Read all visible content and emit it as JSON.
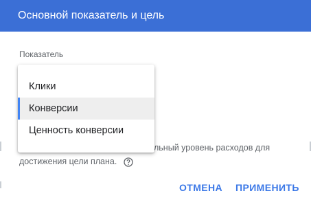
{
  "dialog": {
    "title": "Основной показатель и цель",
    "metric_label": "Показатель",
    "description_visible": "льный уровень расходов для",
    "description_line2": "достижения цели плана.",
    "help_icon": "question-circle-icon",
    "cancel_label": "ОТМЕНА",
    "apply_label": "ПРИМЕНИТЬ"
  },
  "dropdown": {
    "options": [
      {
        "label": "Клики",
        "selected": false
      },
      {
        "label": "Конверсии",
        "selected": true
      },
      {
        "label": "Ценность конверсии",
        "selected": false
      }
    ]
  },
  "colors": {
    "header_bg": "#3b6fd6",
    "accent": "#3b78e7",
    "selected_bar": "#4285f4"
  }
}
